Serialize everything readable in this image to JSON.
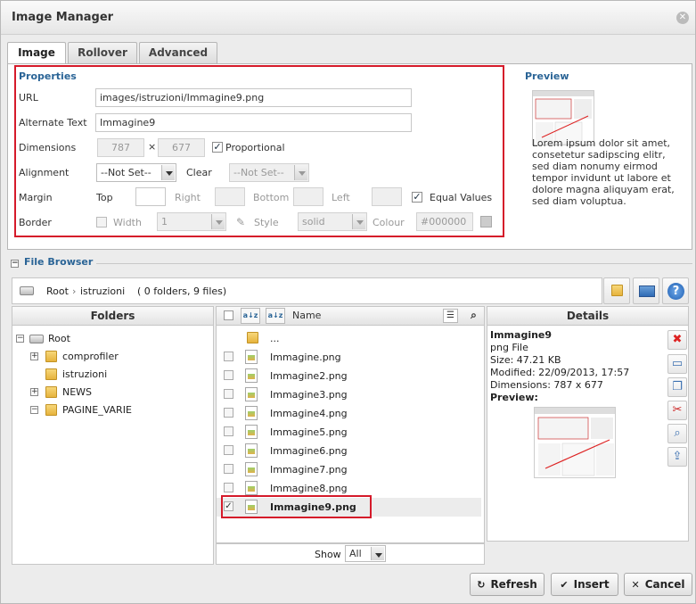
{
  "window": {
    "title": "Image Manager"
  },
  "tabs": [
    {
      "label": "Image",
      "active": true
    },
    {
      "label": "Rollover",
      "active": false
    },
    {
      "label": "Advanced",
      "active": false
    }
  ],
  "properties": {
    "title": "Properties",
    "url_label": "URL",
    "url_value": "images/istruzioni/Immagine9.png",
    "alt_label": "Alternate Text",
    "alt_value": "Immagine9",
    "dimensions_label": "Dimensions",
    "width_value": "787",
    "times": "×",
    "height_value": "677",
    "proportional_label": "Proportional",
    "proportional_checked": true,
    "alignment_label": "Alignment",
    "alignment_value": "--Not Set--",
    "clear_label": "Clear",
    "clear_value": "--Not Set--",
    "margin_label": "Margin",
    "margin_top": "Top",
    "margin_right": "Right",
    "margin_bottom": "Bottom",
    "margin_left": "Left",
    "equal_values_label": "Equal Values",
    "equal_values_checked": true,
    "border_label": "Border",
    "border_width_label": "Width",
    "border_width_value": "1",
    "border_style_label": "Style",
    "border_style_value": "solid",
    "border_colour_label": "Colour",
    "border_colour_value": "#000000"
  },
  "preview": {
    "title": "Preview",
    "text": "Lorem ipsum dolor sit amet, consetetur sadipscing elitr, sed diam nonumy eirmod tempor invidunt ut labore et dolore magna aliquyam erat, sed diam voluptua."
  },
  "file_browser": {
    "title": "File Browser",
    "path_root": "Root",
    "path_sep": "›",
    "path_folder": "istruzioni",
    "path_counts": "( 0 folders, 9 files)",
    "folders_header": "Folders",
    "name_header": "Name",
    "details_header": "Details",
    "tree": [
      {
        "label": "Root",
        "level": 0,
        "toggle": "−"
      },
      {
        "label": "comprofiler",
        "level": 1,
        "toggle": "+"
      },
      {
        "label": "istruzioni",
        "level": 1,
        "toggle": ""
      },
      {
        "label": "NEWS",
        "level": 1,
        "toggle": "+"
      },
      {
        "label": "PAGINE_VARIE",
        "level": 1,
        "toggle": "−"
      }
    ],
    "parent_label": "...",
    "files": [
      {
        "name": "Immagine.png",
        "selected": false
      },
      {
        "name": "Immagine2.png",
        "selected": false
      },
      {
        "name": "Immagine3.png",
        "selected": false
      },
      {
        "name": "Immagine4.png",
        "selected": false
      },
      {
        "name": "Immagine5.png",
        "selected": false
      },
      {
        "name": "Immagine6.png",
        "selected": false
      },
      {
        "name": "Immagine7.png",
        "selected": false
      },
      {
        "name": "Immagine8.png",
        "selected": false
      },
      {
        "name": "Immagine9.png",
        "selected": true
      }
    ],
    "show_label": "Show",
    "show_value": "All",
    "details": {
      "name": "Immagine9",
      "type": "png File",
      "size": "Size: 47.21 KB",
      "modified": "Modified: 22/09/2013, 17:57",
      "dimensions": "Dimensions: 787 x 677",
      "preview_label": "Preview:"
    }
  },
  "buttons": {
    "refresh": "Refresh",
    "insert": "Insert",
    "cancel": "Cancel"
  },
  "colors": {
    "accent": "#2a6496",
    "highlight": "#d51a2a"
  }
}
